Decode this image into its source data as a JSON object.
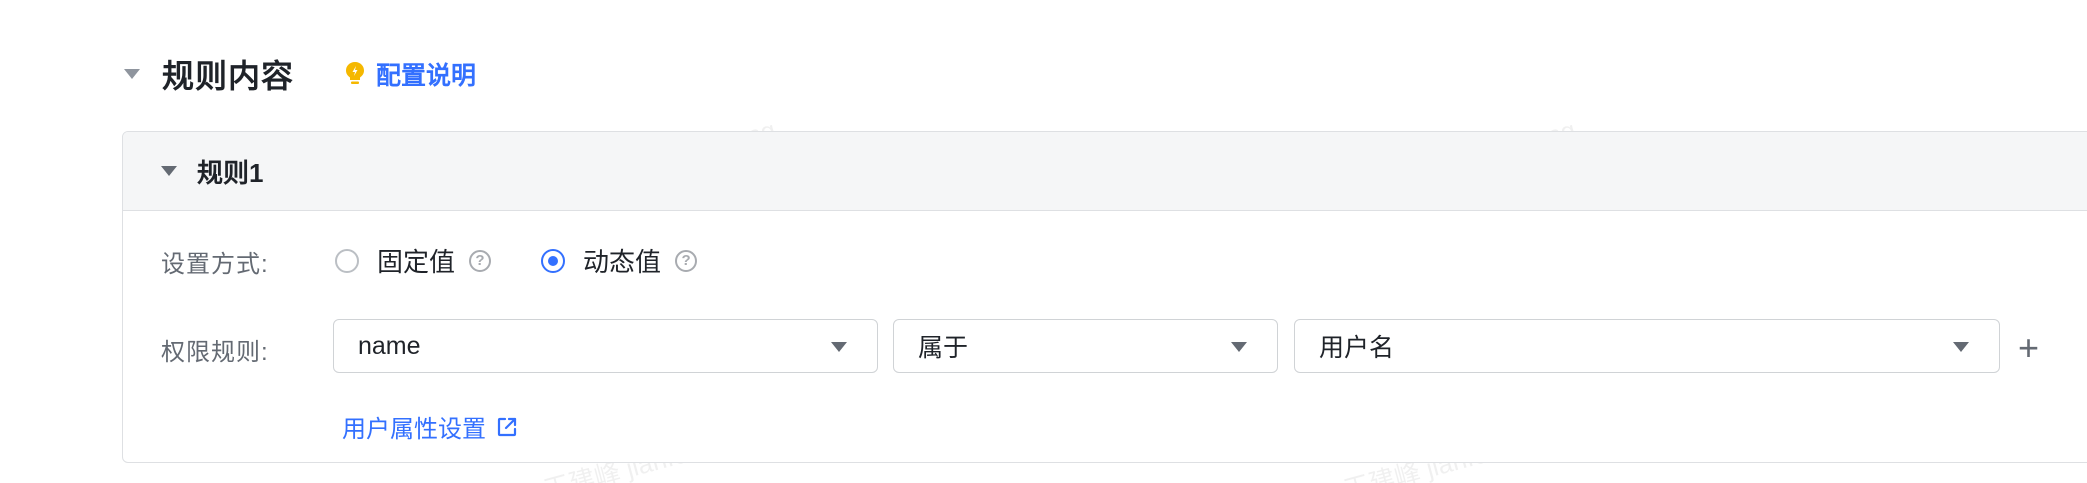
{
  "section": {
    "title": "规则内容",
    "config_link": "配置说明"
  },
  "rule": {
    "title": "规则1",
    "setting_label": "设置方式:",
    "options": [
      {
        "label": "固定值",
        "checked": false
      },
      {
        "label": "动态值",
        "checked": true
      }
    ],
    "permission_label": "权限规则:",
    "field_select": "name",
    "operator_select": "属于",
    "value_select": "用户名",
    "attr_link": "用户属性设置"
  },
  "watermark": "王建峰 jianfengwang",
  "colors": {
    "accent": "#3370ff",
    "bulb": "#f5b800"
  },
  "icons": {
    "help": "?",
    "plus": "+"
  }
}
